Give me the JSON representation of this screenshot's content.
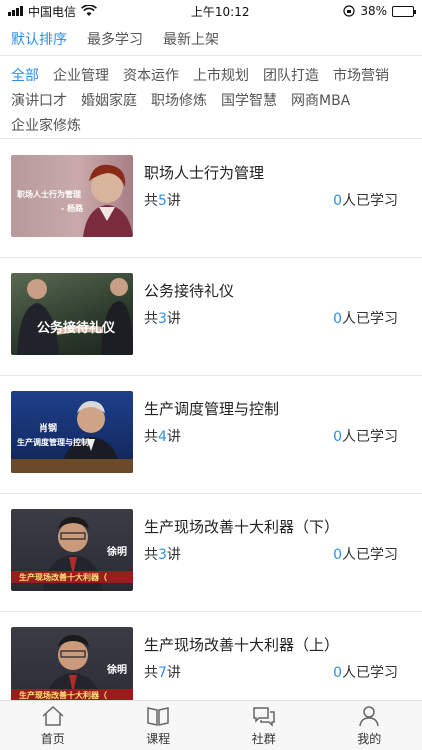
{
  "status_bar": {
    "carrier": "中国电信",
    "time": "上午10:12",
    "battery_text": "38%",
    "battery_level": 0.38
  },
  "sort_tabs": [
    {
      "label": "默认排序",
      "active": true
    },
    {
      "label": "最多学习",
      "active": false
    },
    {
      "label": "最新上架",
      "active": false
    }
  ],
  "categories": [
    {
      "label": "全部",
      "active": true
    },
    {
      "label": "企业管理",
      "active": false
    },
    {
      "label": "资本运作",
      "active": false
    },
    {
      "label": "上市规划",
      "active": false
    },
    {
      "label": "团队打造",
      "active": false
    },
    {
      "label": "市场营销",
      "active": false
    },
    {
      "label": "演讲口才",
      "active": false
    },
    {
      "label": "婚姻家庭",
      "active": false
    },
    {
      "label": "职场修炼",
      "active": false
    },
    {
      "label": "国学智慧",
      "active": false
    },
    {
      "label": "网商MBA",
      "active": false
    },
    {
      "label": "企业家修炼",
      "active": false
    }
  ],
  "courses": [
    {
      "title": "职场人士行为管理",
      "lectures_prefix": "共",
      "lectures": "5",
      "lectures_suffix": "讲",
      "learners": "0",
      "learners_suffix": "人已学习",
      "thumb_text": [
        "职场人士行为管理",
        "- 杨路"
      ]
    },
    {
      "title": "公务接待礼仪",
      "lectures_prefix": "共",
      "lectures": "3",
      "lectures_suffix": "讲",
      "learners": "0",
      "learners_suffix": "人已学习",
      "thumb_text": [
        "公务接待礼仪"
      ]
    },
    {
      "title": "生产调度管理与控制",
      "lectures_prefix": "共",
      "lectures": "4",
      "lectures_suffix": "讲",
      "learners": "0",
      "learners_suffix": "人已学习",
      "thumb_text": [
        "肖钢",
        "生产调度管理与控制"
      ]
    },
    {
      "title": "生产现场改善十大利器（下）",
      "lectures_prefix": "共",
      "lectures": "3",
      "lectures_suffix": "讲",
      "learners": "0",
      "learners_suffix": "人已学习",
      "thumb_text": [
        "徐明",
        "生产现场改善十大利器（"
      ]
    },
    {
      "title": "生产现场改善十大利器（上）",
      "lectures_prefix": "共",
      "lectures": "7",
      "lectures_suffix": "讲",
      "learners": "0",
      "learners_suffix": "人已学习",
      "thumb_text": [
        "徐明",
        "生产现场改善十大利器（"
      ]
    }
  ],
  "tabbar": [
    {
      "label": "首页",
      "icon": "home-icon"
    },
    {
      "label": "课程",
      "icon": "book-icon"
    },
    {
      "label": "社群",
      "icon": "chat-icon"
    },
    {
      "label": "我的",
      "icon": "person-icon"
    }
  ],
  "colors": {
    "accent": "#2f8fe8"
  }
}
